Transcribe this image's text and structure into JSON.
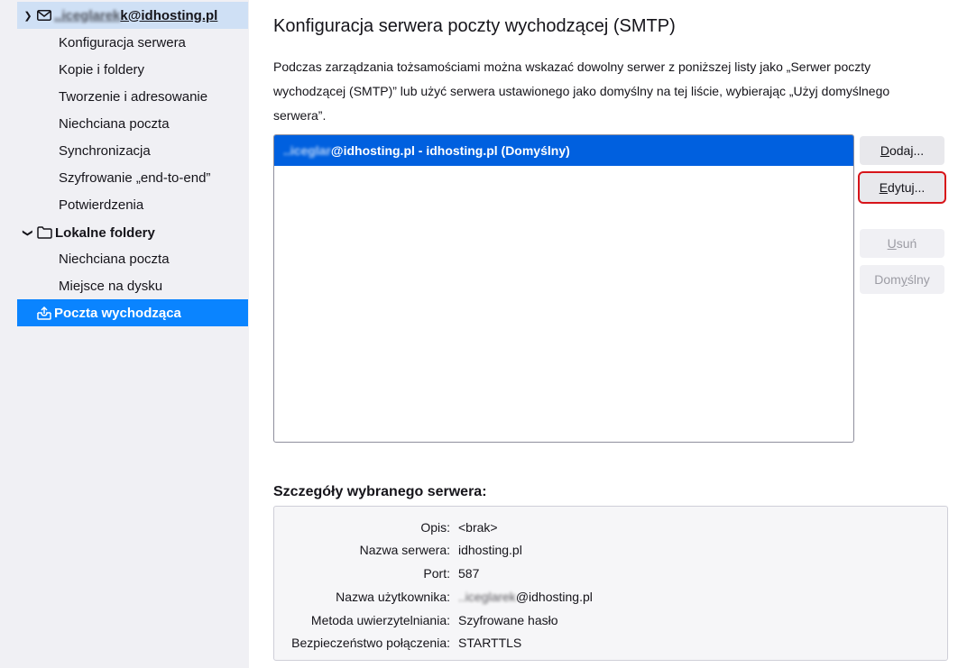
{
  "sidebar": {
    "account": {
      "label_hidden": "..iceglarek",
      "label_visible": "k@idhosting.pl",
      "items": [
        "Konfiguracja serwera",
        "Kopie i foldery",
        "Tworzenie i adresowanie",
        "Niechciana poczta",
        "Synchronizacja",
        "Szyfrowanie „end-to-end”",
        "Potwierdzenia"
      ]
    },
    "local_folders": {
      "label": "Lokalne foldery",
      "items": [
        "Niechciana poczta",
        "Miejsce na dysku"
      ]
    },
    "outgoing": {
      "label": "Poczta wychodząca"
    }
  },
  "main": {
    "title": "Konfiguracja serwera poczty wychodzącej (SMTP)",
    "description": "Podczas zarządzania tożsamościami można wskazać dowolny serwer z poniższej listy jako „Serwer poczty wychodzącej (SMTP)” lub użyć serwera ustawionego jako domyślny na tej liście, wybierając „Użyj domyślnego serwera”.",
    "server_list": [
      {
        "hidden_part": "..iceglar",
        "label": "@idhosting.pl - idhosting.pl (Domyślny)"
      }
    ],
    "buttons": {
      "add": {
        "pre": "",
        "u": "D",
        "post": "odaj..."
      },
      "edit": {
        "pre": "",
        "u": "E",
        "post": "dytuj..."
      },
      "remove": {
        "pre": "",
        "u": "U",
        "post": "suń"
      },
      "default": {
        "pre": "Dom",
        "u": "y",
        "post": "ślny"
      }
    },
    "details": {
      "title": "Szczegóły wybranego serwera:",
      "rows": [
        {
          "label": "Opis:",
          "value": "<brak>"
        },
        {
          "label": "Nazwa serwera:",
          "value": "idhosting.pl"
        },
        {
          "label": "Port:",
          "value": "587"
        },
        {
          "label": "Nazwa użytkownika:",
          "value_hidden": "..iceglarek",
          "value": "@idhosting.pl"
        },
        {
          "label": "Metoda uwierzytelniania:",
          "value": "Szyfrowane hasło"
        },
        {
          "label": "Bezpieczeństwo połączenia:",
          "value": "STARTTLS"
        }
      ]
    }
  }
}
